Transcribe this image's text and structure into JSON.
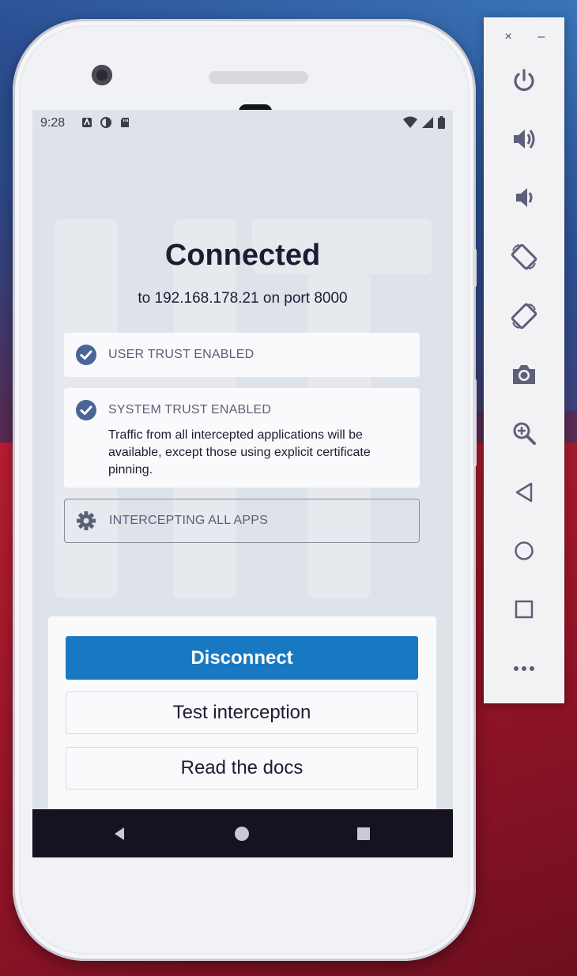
{
  "statusbar": {
    "time": "9:28"
  },
  "main": {
    "title": "Connected",
    "subtitle": "to 192.168.178.21 on port 8000",
    "user_trust": {
      "label": "USER TRUST ENABLED"
    },
    "system_trust": {
      "label": "SYSTEM TRUST ENABLED",
      "description": "Traffic from all intercepted applications will be available, except those using explicit certificate pinning."
    },
    "intercepting": {
      "label": "INTERCEPTING ALL APPS"
    }
  },
  "actions": {
    "disconnect": "Disconnect",
    "test": "Test interception",
    "docs": "Read the docs"
  },
  "colors": {
    "primary": "#1879c2",
    "check_icon": "#4a6495",
    "screen_bg": "#dee3ea"
  },
  "toolbar": {
    "close": "×",
    "minimize": "–",
    "buttons": [
      "power-icon",
      "volume-up-icon",
      "volume-down-icon",
      "rotate-left-icon",
      "rotate-right-icon",
      "camera-icon",
      "zoom-icon",
      "back-icon",
      "home-icon",
      "overview-icon",
      "more-icon"
    ]
  }
}
